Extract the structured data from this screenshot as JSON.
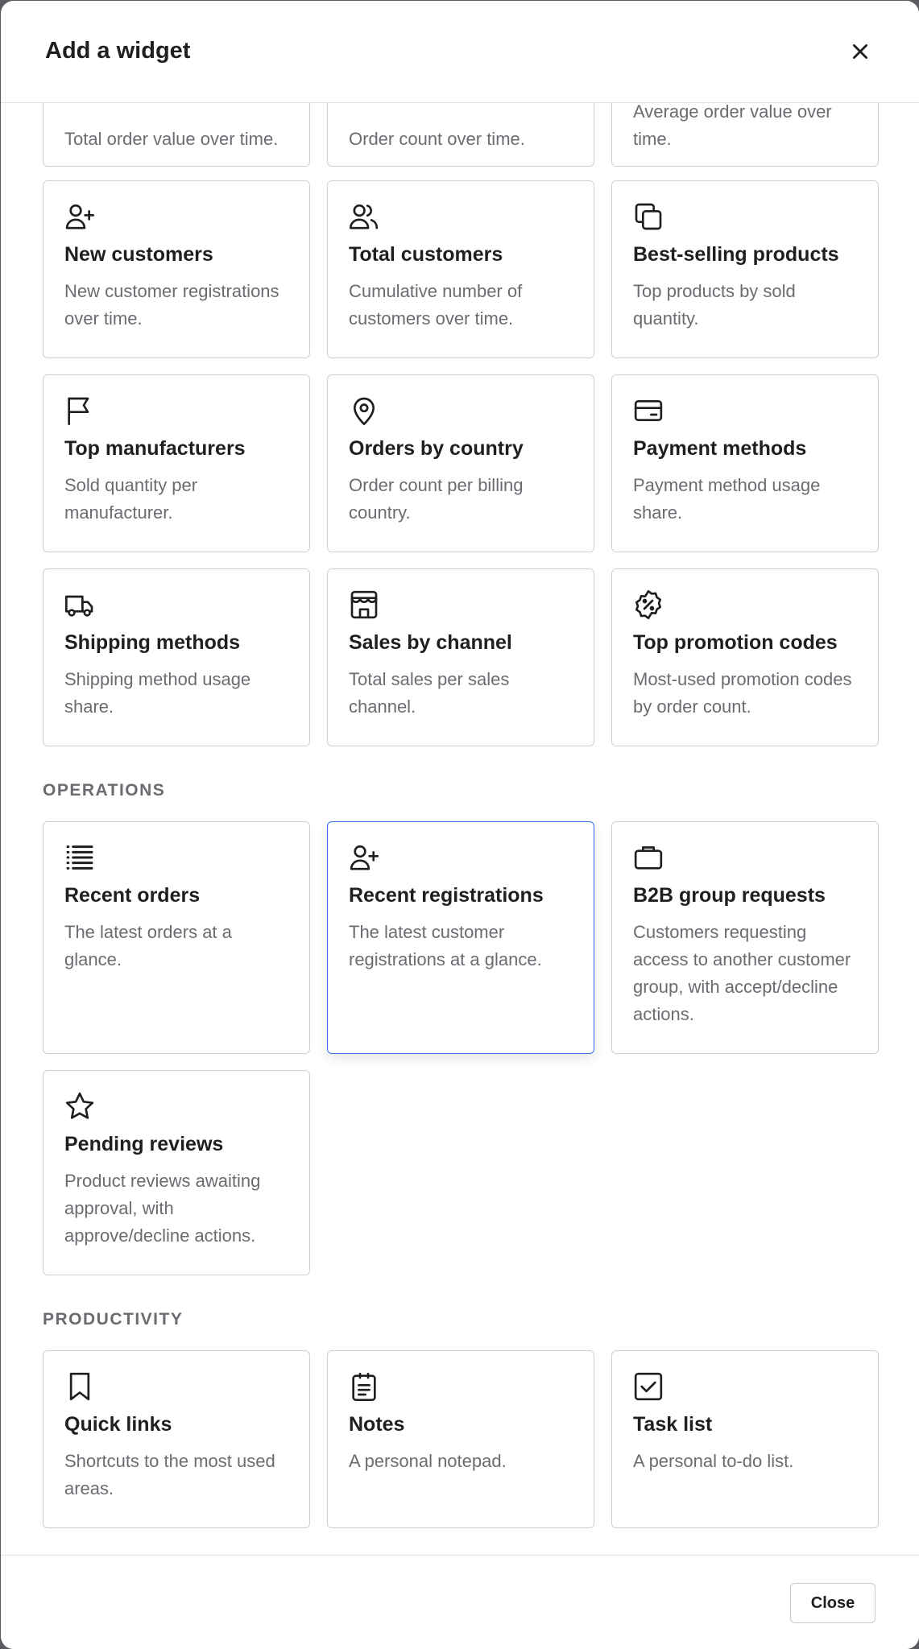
{
  "modal": {
    "title": "Add a widget",
    "close_label": "Close"
  },
  "partial_row": [
    {
      "desc": "Total order value over time."
    },
    {
      "desc": "Order count over time."
    },
    {
      "desc": "Average order value over time."
    }
  ],
  "sales_cards": [
    {
      "icon": "user-plus-icon",
      "title": "New customers",
      "desc": "New customer registrations over time."
    },
    {
      "icon": "users-icon",
      "title": "Total customers",
      "desc": "Cumulative number of customers over time."
    },
    {
      "icon": "copy-icon",
      "title": "Best-selling products",
      "desc": "Top products by sold quantity."
    },
    {
      "icon": "flag-icon",
      "title": "Top manufacturers",
      "desc": "Sold quantity per manufacturer."
    },
    {
      "icon": "map-pin-icon",
      "title": "Orders by country",
      "desc": "Order count per billing country."
    },
    {
      "icon": "credit-card-icon",
      "title": "Payment methods",
      "desc": "Payment method usage share."
    },
    {
      "icon": "truck-icon",
      "title": "Shipping methods",
      "desc": "Shipping method usage share."
    },
    {
      "icon": "store-icon",
      "title": "Sales by channel",
      "desc": "Total sales per sales channel."
    },
    {
      "icon": "discount-badge-icon",
      "title": "Top promotion codes",
      "desc": "Most-used promotion codes by order count."
    }
  ],
  "operations": {
    "label": "OPERATIONS",
    "cards": [
      {
        "icon": "list-icon",
        "title": "Recent orders",
        "desc": "The latest orders at a glance."
      },
      {
        "icon": "user-plus-icon",
        "title": "Recent registrations",
        "desc": "The latest customer registrations at a glance."
      },
      {
        "icon": "briefcase-icon",
        "title": "B2B group requests",
        "desc": "Customers requesting access to another customer group, with accept/decline actions."
      },
      {
        "icon": "star-icon",
        "title": "Pending reviews",
        "desc": "Product reviews awaiting approval, with approve/decline actions."
      }
    ]
  },
  "productivity": {
    "label": "PRODUCTIVITY",
    "cards": [
      {
        "icon": "bookmark-icon",
        "title": "Quick links",
        "desc": "Shortcuts to the most used areas."
      },
      {
        "icon": "notepad-icon",
        "title": "Notes",
        "desc": "A personal notepad."
      },
      {
        "icon": "checkbox-icon",
        "title": "Task list",
        "desc": "A personal to-do list."
      }
    ]
  },
  "colors": {
    "selected_border": "#3b6ee6",
    "card_border": "#cfcfd4",
    "text_primary": "#1f1f23",
    "text_muted": "#6b6b72"
  }
}
